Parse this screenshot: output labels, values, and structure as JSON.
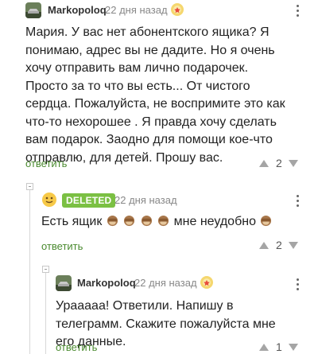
{
  "comments": [
    {
      "author": "Markopoloq",
      "time": "22 дня назад",
      "text": "Мария. У вас нет абонентского ящика? Я понимаю, адрес вы не дадите. Но я очень хочу отправить вам лично подарочек. Просто за то что вы есть... От чистого сердца. Пожалуйста, не воспримите это как что-то нехорошее . Я правда хочу сделать вам подарок. Заодно для помощи кое-что отправлю, для детей. Прошу вас.",
      "reply_label": "ответить",
      "rating": "2"
    },
    {
      "author": "DELETED",
      "time": "22 дня назад",
      "text_before": "Есть ящик",
      "text_after": "мне неудобно",
      "reply_label": "ответить",
      "rating": "2",
      "badge_color": "#7bc043"
    },
    {
      "author": "Markopoloq",
      "time": "22 дня назад",
      "text": "Урааааа! Ответили. Напишу в телеграмм. Скажите пожалуйста мне его данные.",
      "reply_label": "ответить",
      "rating": "1"
    }
  ],
  "icons": {
    "author_avatar": "car-avatar-icon",
    "deleted_avatar": "smiley-avatar-icon",
    "award": "award-rosette-icon",
    "emoji": "see-no-evil-monkey-icon",
    "menu": "more-vertical-icon"
  },
  "colors": {
    "accent": "#4a8a2f",
    "deleted_badge": "#7bc043"
  }
}
